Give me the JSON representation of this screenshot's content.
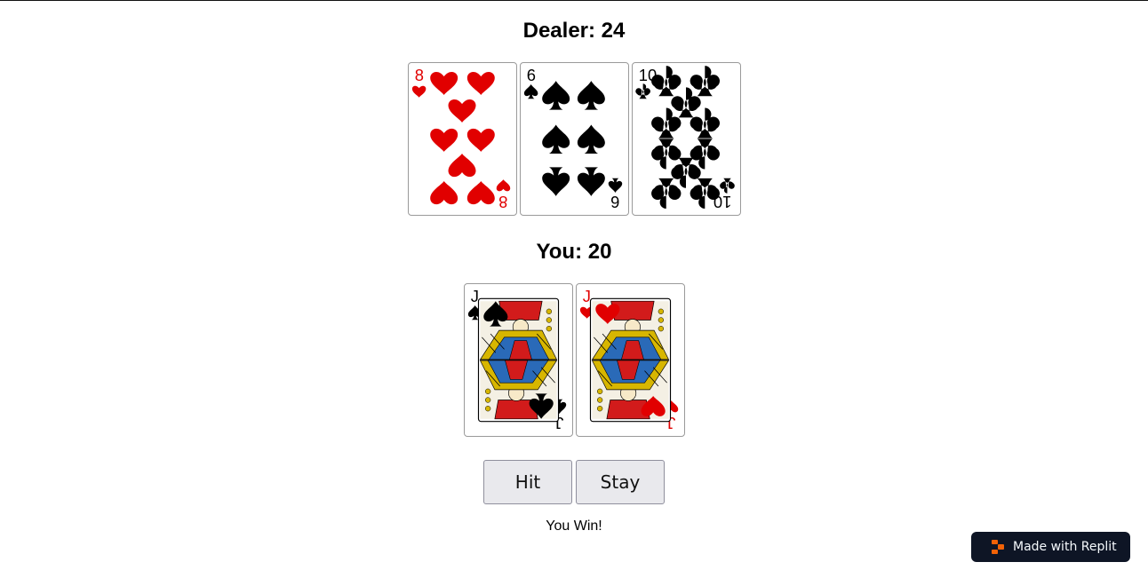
{
  "dealer": {
    "label": "Dealer: 24",
    "cards": [
      {
        "rank": "8",
        "suit": "hearts",
        "color": "#e10000"
      },
      {
        "rank": "6",
        "suit": "spades",
        "color": "#000000"
      },
      {
        "rank": "10",
        "suit": "clubs",
        "color": "#000000"
      }
    ]
  },
  "player": {
    "label": "You: 20",
    "cards": [
      {
        "rank": "J",
        "suit": "spades",
        "color": "#000000"
      },
      {
        "rank": "J",
        "suit": "hearts",
        "color": "#e10000"
      }
    ]
  },
  "controls": {
    "hit_label": "Hit",
    "stay_label": "Stay"
  },
  "result": "You Win!",
  "badge": {
    "label": "Made with Replit",
    "logo_color": "#f26207",
    "background": "#0e1525"
  },
  "icons": {
    "hearts": "heart-icon",
    "spades": "spade-icon",
    "clubs": "club-icon",
    "replit": "replit-logo-icon"
  }
}
